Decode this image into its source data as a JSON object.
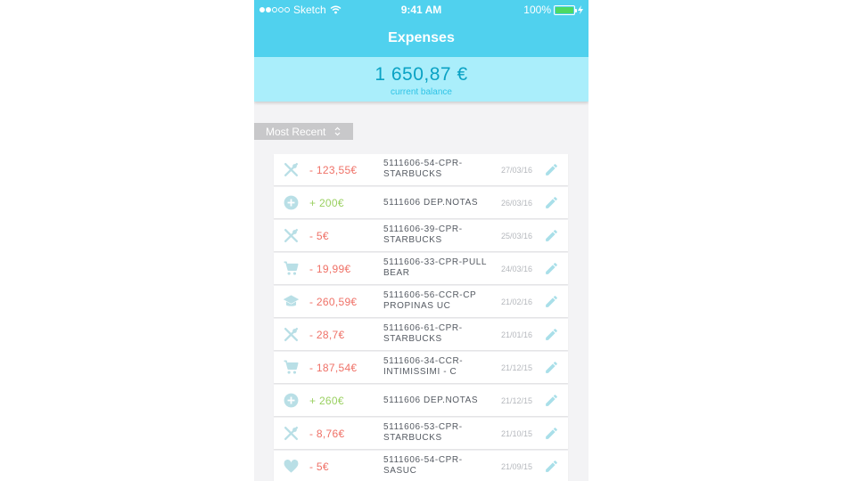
{
  "status": {
    "carrier": "Sketch",
    "time": "9:41 AM",
    "battery": "100%"
  },
  "nav": {
    "title": "Expenses"
  },
  "balance": {
    "amount": "1 650,87 €",
    "label": "current balance"
  },
  "sort": {
    "label": "Most Recent"
  },
  "colors": {
    "accent": "#50d1ee",
    "negative": "#ef7167",
    "positive": "#9ad061",
    "icon": "#b9dfe6"
  },
  "transactions": [
    {
      "icon": "restaurant-icon",
      "amount": "- 123,55€",
      "type": "neg",
      "desc": "5111606-54-CPR-STARBUCKS",
      "date": "27/03/16"
    },
    {
      "icon": "add-circle-icon",
      "amount": "+ 200€",
      "type": "pos",
      "desc": "5111606 DEP.NOTAS",
      "date": "26/03/16"
    },
    {
      "icon": "restaurant-icon",
      "amount": "- 5€",
      "type": "neg",
      "desc": "5111606-39-CPR-STARBUCKS",
      "date": "25/03/16"
    },
    {
      "icon": "cart-icon",
      "amount": "- 19,99€",
      "type": "neg",
      "desc": "5111606-33-CPR-PULL BEAR",
      "date": "24/03/16"
    },
    {
      "icon": "graduation-cap-icon",
      "amount": "- 260,59€",
      "type": "neg",
      "desc": "5111606-56-CCR-CP PROPINAS UC",
      "date": "21/02/16"
    },
    {
      "icon": "restaurant-icon",
      "amount": "- 28,7€",
      "type": "neg",
      "desc": "5111606-61-CPR-STARBUCKS",
      "date": "21/01/16"
    },
    {
      "icon": "cart-icon",
      "amount": "- 187,54€",
      "type": "neg",
      "desc": "5111606-34-CCR-INTIMISSIMI - C",
      "date": "21/12/15"
    },
    {
      "icon": "add-circle-icon",
      "amount": "+ 260€",
      "type": "pos",
      "desc": "5111606 DEP.NOTAS",
      "date": "21/12/15"
    },
    {
      "icon": "restaurant-icon",
      "amount": "- 8,76€",
      "type": "neg",
      "desc": "5111606-53-CPR-STARBUCKS",
      "date": "21/10/15"
    },
    {
      "icon": "heart-icon",
      "amount": "- 5€",
      "type": "neg",
      "desc": "5111606-54-CPR-SASUC",
      "date": "21/09/15"
    }
  ]
}
